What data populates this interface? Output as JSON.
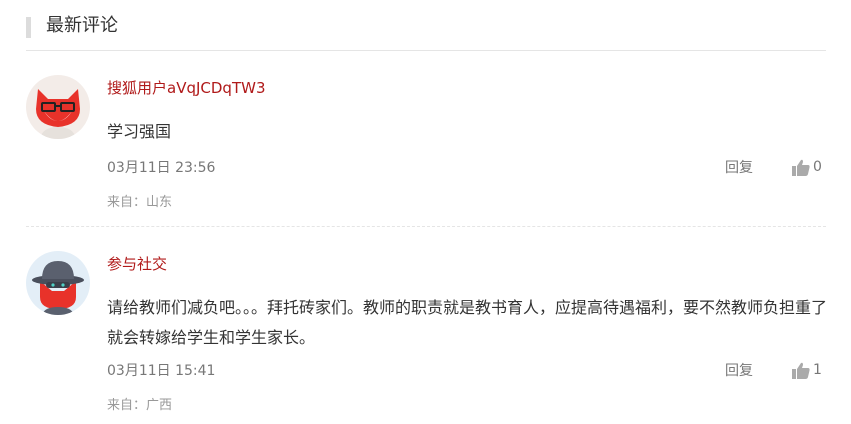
{
  "section": {
    "title": "最新评论"
  },
  "comments": [
    {
      "username": "搜狐用户aVqJCDqTW3",
      "content": "学习强国",
      "time": "03月11日 23:56",
      "reply_label": "回复",
      "likes": "0",
      "location": "来自：山东",
      "avatar_icon": "fox-with-glasses-avatar"
    },
    {
      "username": "参与社交",
      "content": "请给教师们减负吧。。。拜托砖家们。教师的职责就是教书育人，应提高待遇福利，要不然教师负担重了就会转嫁给学生和学生家长。",
      "time": "03月11日 15:41",
      "reply_label": "回复",
      "likes": "1",
      "location": "来自：广西",
      "avatar_icon": "fox-with-hat-avatar"
    }
  ],
  "colors": {
    "username": "#b01a1a",
    "meta": "#777777",
    "location": "#999999",
    "divider": "#e5e5e5",
    "header_bar": "#dcdcdc"
  }
}
